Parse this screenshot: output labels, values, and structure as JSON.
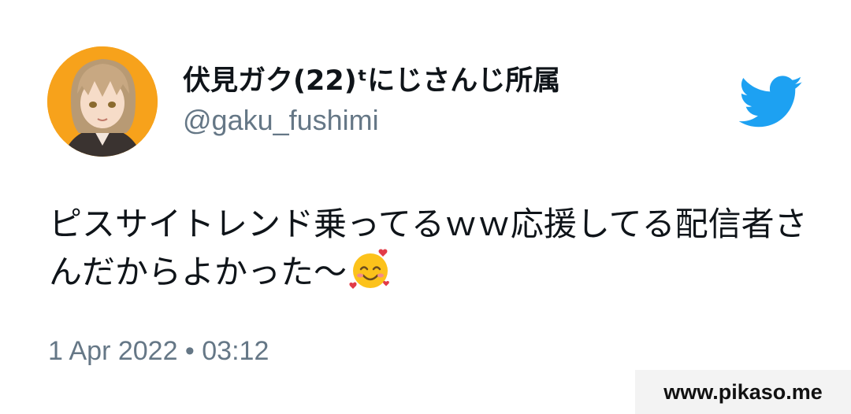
{
  "tweet": {
    "author": {
      "display_name": "伏見ガク(22)ᵗにじさんじ所属",
      "handle": "@gaku_fushimi",
      "avatar_icon": "avatar-anime-character"
    },
    "brand_icon": "twitter-bird-icon",
    "brand_color": "#1da1f2",
    "text": "ピスサイトレンド乗ってるｗｗ応援してる配信者さんだからよかった〜",
    "emoji_icon": "smiling-face-with-hearts-emoji",
    "timestamp": "1 Apr 2022 • 03:12"
  },
  "watermark": {
    "text": "www.pikaso.me"
  }
}
